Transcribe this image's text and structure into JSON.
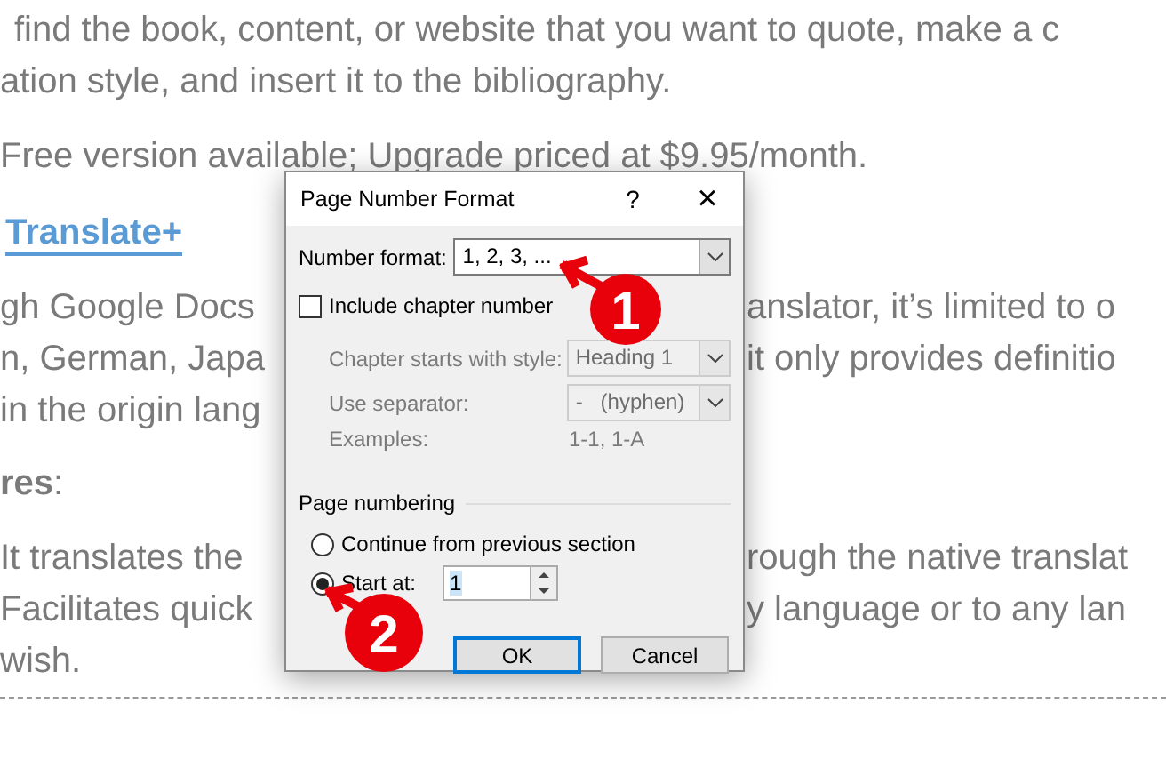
{
  "article": [
    {
      "kind": "paragraph",
      "lines": [
        {
          "left": "find the book, content, or website that you want to quote, make a c"
        },
        {
          "left": "ation style, and insert it to the bibliography."
        }
      ]
    },
    {
      "kind": "paragraph",
      "lines": [
        {
          "left": "Free version available; Upgrade priced at $9.95/month."
        }
      ]
    },
    {
      "kind": "link_heading",
      "text": "Translate+"
    },
    {
      "kind": "paragraph",
      "lines": [
        {
          "left": "gh Google Docs",
          "right": "anslator, it’s limited to o"
        },
        {
          "left": "n, German, Japa",
          "right": "it only provides definitio"
        },
        {
          "left": "in the origin lang"
        }
      ]
    },
    {
      "kind": "heading",
      "text": "**res**:"
    },
    {
      "kind": "paragraph",
      "lines": [
        {
          "left": "It translates the",
          "right": "rough the native translat"
        },
        {
          "left": "Facilitates quick",
          "right": "y language or to any lan"
        },
        {
          "left": "wish."
        }
      ]
    },
    {
      "kind": "divider"
    }
  ],
  "dialog": {
    "title": "Page Number Format",
    "help": "?",
    "close": "×",
    "number_format": {
      "label": "Number format:",
      "value": "1, 2, 3, ..."
    },
    "include_chapter": {
      "label": "Include chapter number",
      "checked": false
    },
    "chapter_style": {
      "label": "Chapter starts with style:",
      "value": "Heading 1",
      "disabled": true
    },
    "separator": {
      "label": "Use separator:",
      "value": "-   (hyphen)",
      "disabled": true
    },
    "examples": {
      "label": "Examples:",
      "value": "1-1, 1-A",
      "disabled": true
    },
    "page_numbering": {
      "title": "Page numbering",
      "options": [
        {
          "label": "Continue from previous section",
          "selected": false
        },
        {
          "label": "Start at:",
          "selected": true
        }
      ],
      "start_at": "1"
    },
    "buttons": [
      {
        "label": "OK",
        "default": true
      },
      {
        "label": "Cancel",
        "default": false
      }
    ]
  },
  "annotations": [
    {
      "text": "1"
    },
    {
      "text": "2"
    }
  ]
}
